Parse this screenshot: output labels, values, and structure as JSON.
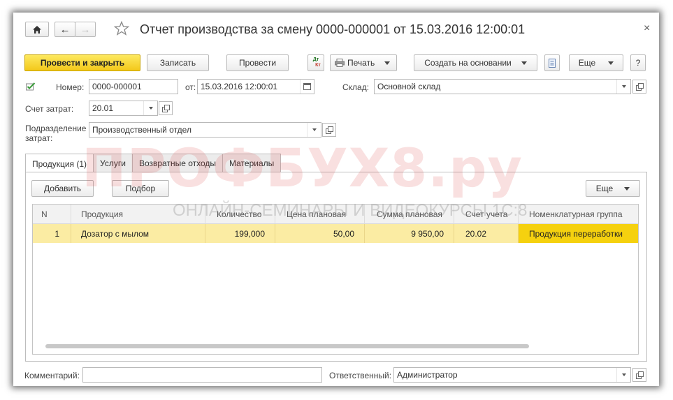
{
  "window": {
    "title": "Отчет производства за смену 0000-000001 от 15.03.2016 12:00:01",
    "close": "×"
  },
  "toolbar": {
    "post_and_close": "Провести и закрыть",
    "save": "Записать",
    "post": "Провести",
    "dt_kt_top": "Дт",
    "dt_kt_bottom": "Кт",
    "print": "Печать",
    "create_based_on": "Создать на основании",
    "more": "Еще",
    "help": "?"
  },
  "form": {
    "number_label": "Номер:",
    "number_value": "0000-000001",
    "date_label": "от:",
    "date_value": "15.03.2016 12:00:01",
    "warehouse_label": "Склад:",
    "warehouse_value": "Основной склад",
    "cost_account_label": "Счет затрат:",
    "cost_account_value": "20.01",
    "division_label_line1": "Подразделение",
    "division_label_line2": "затрат:",
    "division_value": "Производственный отдел",
    "comment_label": "Комментарий:",
    "comment_value": "",
    "responsible_label": "Ответственный:",
    "responsible_value": "Администратор"
  },
  "tabs": [
    {
      "label": "Продукция (1)"
    },
    {
      "label": "Услуги"
    },
    {
      "label": "Возвратные отходы"
    },
    {
      "label": "Материалы"
    }
  ],
  "table_toolbar": {
    "add": "Добавить",
    "select": "Подбор",
    "more": "Еще"
  },
  "table": {
    "columns": [
      "N",
      "Продукция",
      "Количество",
      "Цена плановая",
      "Сумма плановая",
      "Счет учета",
      "Номенклатурная группа"
    ],
    "rows": [
      {
        "n": "1",
        "product": "Дозатор с мылом",
        "qty": "199,000",
        "price": "50,00",
        "sum": "9 950,00",
        "account": "20.02",
        "group": "Продукция переработки"
      }
    ]
  },
  "watermark": {
    "main": "ПРОФБУХ8.ру",
    "sub": "ОНЛАЙН-СЕМИНАРЫ И ВИДЕОКУРСЫ 1С:8"
  },
  "colors": {
    "primary_button": "#f3c81a",
    "selected_row": "#fbeca3",
    "selected_cell": "#f5d10f"
  }
}
